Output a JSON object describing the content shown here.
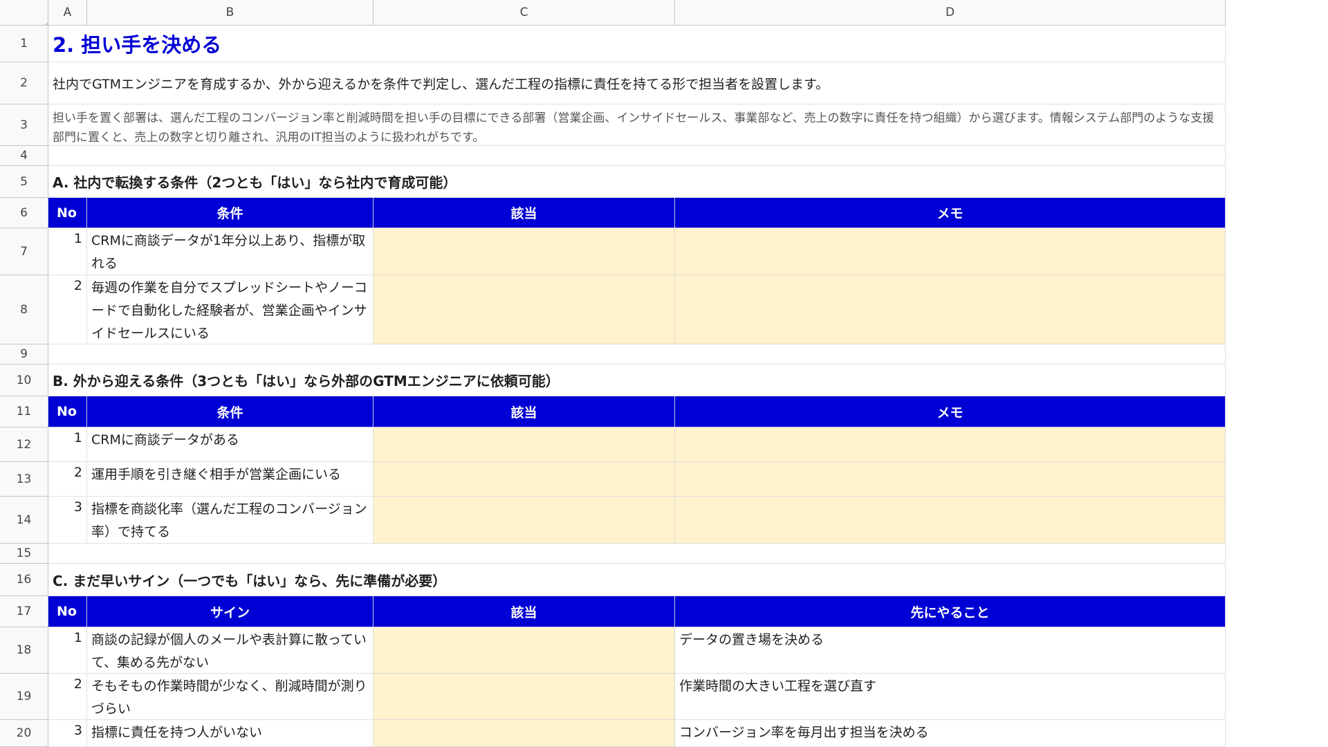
{
  "columns": [
    "A",
    "B",
    "C",
    "D"
  ],
  "rows": [
    "1",
    "2",
    "3",
    "4",
    "5",
    "6",
    "7",
    "8",
    "9",
    "10",
    "11",
    "12",
    "13",
    "14",
    "15",
    "16",
    "17",
    "18",
    "19",
    "20"
  ],
  "title": "2. 担い手を決める",
  "intro": "社内でGTMエンジニアを育成するか、外から迎えるかを条件で判定し、選んだ工程の指標に責任を持てる形で担当者を設置します。",
  "note": "担い手を置く部署は、選んだ工程のコンバージョン率と削減時間を担い手の目標にできる部署（営業企画、インサイドセールス、事業部など、売上の数字に責任を持つ組織）から選びます。情報システム部門のような支援部門に置くと、売上の数字と切り離され、汎用のIT担当のように扱われがちです。",
  "sectionA": {
    "heading": "A. 社内で転換する条件（2つとも「はい」なら社内で育成可能）",
    "headers": [
      "No",
      "条件",
      "該当",
      "メモ"
    ],
    "rows": [
      {
        "no": "1",
        "text": "CRMに商談データが1年分以上あり、指標が取れる",
        "applies": "",
        "memo": ""
      },
      {
        "no": "2",
        "text": "毎週の作業を自分でスプレッドシートやノーコードで自動化した経験者が、営業企画やインサイドセールスにいる",
        "applies": "",
        "memo": ""
      }
    ]
  },
  "sectionB": {
    "heading": "B. 外から迎える条件（3つとも「はい」なら外部のGTMエンジニアに依頼可能）",
    "headers": [
      "No",
      "条件",
      "該当",
      "メモ"
    ],
    "rows": [
      {
        "no": "1",
        "text": "CRMに商談データがある",
        "applies": "",
        "memo": ""
      },
      {
        "no": "2",
        "text": "運用手順を引き継ぐ相手が営業企画にいる",
        "applies": "",
        "memo": ""
      },
      {
        "no": "3",
        "text": "指標を商談化率（選んだ工程のコンバージョン率）で持てる",
        "applies": "",
        "memo": ""
      }
    ]
  },
  "sectionC": {
    "heading": "C. まだ早いサイン（一つでも「はい」なら、先に準備が必要）",
    "headers": [
      "No",
      "サイン",
      "該当",
      "先にやること"
    ],
    "rows": [
      {
        "no": "1",
        "text": "商談の記録が個人のメールや表計算に散っていて、集める先がない",
        "applies": "",
        "todo": "データの置き場を決める"
      },
      {
        "no": "2",
        "text": "そもそもの作業時間が少なく、削減時間が測りづらい",
        "applies": "",
        "todo": "作業時間の大きい工程を選び直す"
      },
      {
        "no": "3",
        "text": "指標に責任を持つ人がいない",
        "applies": "",
        "todo": "コンバージョン率を毎月出す担当を決める"
      }
    ]
  },
  "colors": {
    "header_blue": "#0000d4",
    "input_yellow": "#fff2cc"
  }
}
